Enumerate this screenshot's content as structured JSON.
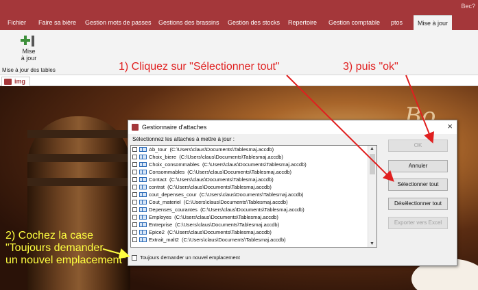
{
  "app": {
    "title_right": "Bec?"
  },
  "ribbon": {
    "tabs": [
      {
        "label": "Fichier",
        "active": false
      },
      {
        "label": "Faire sa bière",
        "active": false
      },
      {
        "label": "Gestion mots de passes",
        "active": false
      },
      {
        "label": "Gestions des brassins",
        "active": false
      },
      {
        "label": "Gestion des stocks",
        "active": false
      },
      {
        "label": "Repertoire",
        "active": false
      },
      {
        "label": "Gestion comptable",
        "active": false
      },
      {
        "label": "ptos",
        "active": false
      },
      {
        "label": "Mise à jour",
        "active": true
      }
    ],
    "button": {
      "line1": "Mise",
      "line2": "à jour",
      "icon": "add-update-icon"
    },
    "group_label": "Mise à jour des tables"
  },
  "document_tab": {
    "label": "img",
    "icon": "form-icon"
  },
  "background": {
    "text": "Bo.."
  },
  "dialog": {
    "title": "Gestionnaire d'attaches",
    "prompt": "Sélectionnez les attaches à mettre à jour :",
    "close_glyph": "×",
    "items": [
      {
        "name": "Ab_tour",
        "path": "(C:\\Users\\claus\\Documents\\Tablesmaj.accdb)"
      },
      {
        "name": "Choix_biere",
        "path": "(C:\\Users\\claus\\Documents\\Tablesmaj.accdb)"
      },
      {
        "name": "Choix_consommables",
        "path": "(C:\\Users\\claus\\Documents\\Tablesmaj.accdb)"
      },
      {
        "name": "Consommables",
        "path": "(C:\\Users\\claus\\Documents\\Tablesmaj.accdb)"
      },
      {
        "name": "Contact",
        "path": "(C:\\Users\\claus\\Documents\\Tablesmaj.accdb)"
      },
      {
        "name": "contrat",
        "path": "(C:\\Users\\claus\\Documents\\Tablesmaj.accdb)"
      },
      {
        "name": "cout_depenses_cour",
        "path": "(C:\\Users\\claus\\Documents\\Tablesmaj.accdb)"
      },
      {
        "name": "Cout_materiel",
        "path": "(C:\\Users\\claus\\Documents\\Tablesmaj.accdb)"
      },
      {
        "name": "Depenses_courantes",
        "path": "(C:\\Users\\claus\\Documents\\Tablesmaj.accdb)"
      },
      {
        "name": "Employes",
        "path": "(C:\\Users\\claus\\Documents\\Tablesmaj.accdb)"
      },
      {
        "name": "Entreprise",
        "path": "(C:\\Users\\claus\\Documents\\Tablesmaj.accdb)"
      },
      {
        "name": "Epice2",
        "path": "(C:\\Users\\claus\\Documents\\Tablesmaj.accdb)"
      },
      {
        "name": "Extrait_malt2",
        "path": "(C:\\Users\\claus\\Documents\\Tablesmaj.accdb)"
      }
    ],
    "always_ask_label": "Toujours demander un nouvel emplacement",
    "buttons": {
      "ok": "OK",
      "cancel": "Annuler",
      "select_all": "Sélectionner tout",
      "deselect_all": "Désélectionner tout",
      "export": "Exporter vers Excel"
    }
  },
  "annotations": {
    "step1": "1) Cliquez sur \"Sélectionner tout\"",
    "step3": "3) puis \"ok\"",
    "step2_line1": "2) Cochez la case",
    "step2_line2": "\"Toujours demander",
    "step2_line3": "un nouvel emplacement\""
  },
  "colors": {
    "accent": "#a4373a",
    "annotation_red": "#e02020",
    "annotation_yellow": "#ffff40"
  }
}
